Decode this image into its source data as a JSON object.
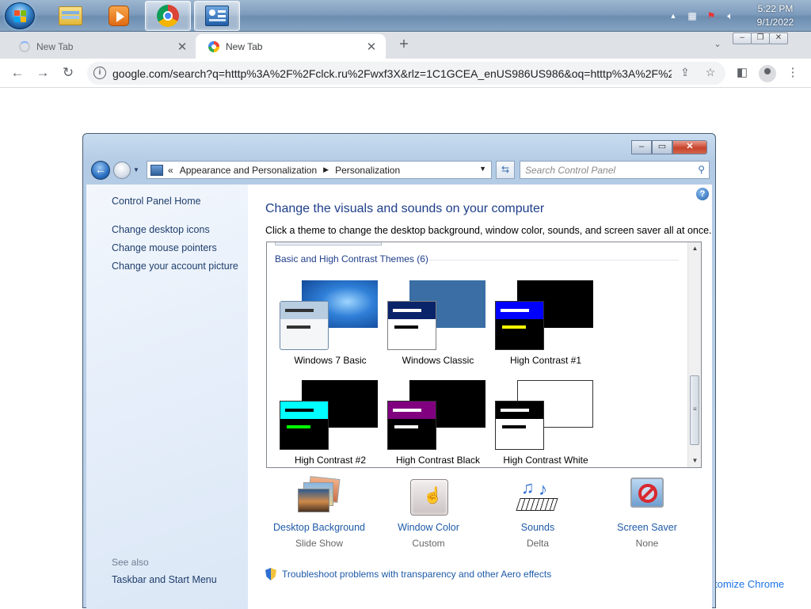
{
  "taskbar": {
    "clock_time": "5:22 PM",
    "clock_date": "9/1/2022"
  },
  "tabs": [
    {
      "label": "New Tab",
      "loading": true
    },
    {
      "label": "New Tab",
      "loading": false,
      "active": true
    }
  ],
  "toolbar": {
    "url": "google.com/search?q=htttp%3A%2F%2Fclck.ru%2Fwxf3X&rlz=1C1GCEA_enUS986US986&oq=htttp%3A%2F%2..."
  },
  "background_page": {
    "customize_chrome_link": "tomize Chrome"
  },
  "control_panel": {
    "breadcrumb": {
      "prefix": "«",
      "items": [
        "Appearance and Personalization",
        "Personalization"
      ]
    },
    "search_placeholder": "Search Control Panel",
    "sidebar": {
      "home_link": "Control Panel Home",
      "links": [
        "Change desktop icons",
        "Change mouse pointers",
        "Change your account picture"
      ],
      "see_also_label": "See also",
      "see_also_links": [
        "Taskbar and Start Menu"
      ]
    },
    "main": {
      "title": "Change the visuals and sounds on your computer",
      "subtitle": "Click a theme to change the desktop background, window color, sounds, and screen saver all at once.",
      "group_label": "Basic and High Contrast Themes (6)",
      "themes": [
        {
          "name": "Windows 7 Basic",
          "bg": "#2a6fc6",
          "fg_body": "#f4f6f8",
          "fg_bar": "#b9cde0",
          "line1": "#333333",
          "line2": "#333333"
        },
        {
          "name": "Windows Classic",
          "bg": "#3a6ea5",
          "fg_body": "#ffffff",
          "fg_bar": "#0a246a",
          "line1": "#ffffff",
          "line2": "#000000"
        },
        {
          "name": "High Contrast #1",
          "bg": "#000000",
          "fg_body": "#000000",
          "fg_bar": "#0000ff",
          "line1": "#ffffff",
          "line2": "#ffff00"
        },
        {
          "name": "High Contrast #2",
          "bg": "#000000",
          "fg_body": "#000000",
          "fg_bar": "#00ffff",
          "line1": "#000000",
          "line2": "#00ff00"
        },
        {
          "name": "High Contrast Black",
          "bg": "#000000",
          "fg_body": "#000000",
          "fg_bar": "#800080",
          "line1": "#ffffff",
          "line2": "#ffffff"
        },
        {
          "name": "High Contrast White",
          "bg": "#ffffff",
          "fg_body": "#ffffff",
          "fg_bar": "#000000",
          "line1": "#ffffff",
          "line2": "#000000"
        }
      ],
      "settings": [
        {
          "name": "Desktop Background",
          "value": "Slide Show",
          "icon": "desktop-background-icon"
        },
        {
          "name": "Window Color",
          "value": "Custom",
          "icon": "window-color-icon"
        },
        {
          "name": "Sounds",
          "value": "Delta",
          "icon": "sounds-icon"
        },
        {
          "name": "Screen Saver",
          "value": "None",
          "icon": "screen-saver-icon"
        }
      ],
      "troubleshoot_link": "Troubleshoot problems with transparency and other Aero effects"
    }
  }
}
